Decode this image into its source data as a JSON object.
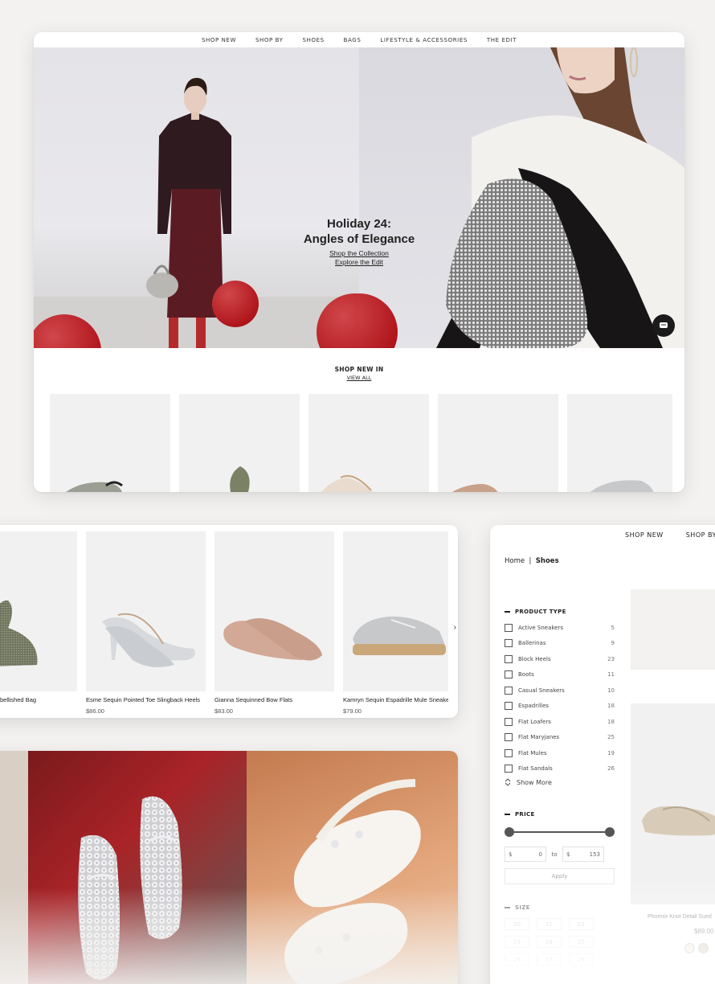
{
  "hero_card": {
    "nav": [
      "SHOP NEW",
      "SHOP BY",
      "SHOES",
      "BAGS",
      "LIFESTYLE & ACCESSORIES",
      "THE EDIT"
    ],
    "hero": {
      "title_line1": "Holiday 24:",
      "title_line2": "Angles of Elegance",
      "link1": "Shop the Collection",
      "link2": "Explore the Edit"
    },
    "chat_icon": "chat-bubble-icon",
    "section_title": "SHOP NEW IN",
    "section_link": "VIEW ALL"
  },
  "products_card": {
    "items": [
      {
        "name": "bellished Bag",
        "price": ""
      },
      {
        "name": "Esme Sequin Pointed Toe Slingback Heels",
        "price": "$86.00"
      },
      {
        "name": "Gianna Sequinned Bow Flats",
        "price": "$83.00"
      },
      {
        "name": "Kamryn Sequin Espadrille Mule Sneakers",
        "price": "$79.00"
      }
    ],
    "next_arrow": "›"
  },
  "shoes_card": {
    "nav": [
      "SHOP NEW",
      "SHOP BY"
    ],
    "breadcrumb": {
      "home": "Home",
      "sep": "|",
      "current": "Shoes"
    },
    "product_type": {
      "heading": "PRODUCT TYPE",
      "options": [
        {
          "label": "Active Sneakers",
          "count": "5"
        },
        {
          "label": "Ballerinas",
          "count": "9"
        },
        {
          "label": "Block Heels",
          "count": "23"
        },
        {
          "label": "Boots",
          "count": "11"
        },
        {
          "label": "Casual Sneakers",
          "count": "10"
        },
        {
          "label": "Espadrilles",
          "count": "18"
        },
        {
          "label": "Flat Loafers",
          "count": "18"
        },
        {
          "label": "Flat Maryjanes",
          "count": "25"
        },
        {
          "label": "Flat Mules",
          "count": "19"
        },
        {
          "label": "Flat Sandals",
          "count": "26"
        }
      ],
      "show_more": "Show More"
    },
    "price": {
      "heading": "PRICE",
      "currency": "$",
      "min": "0",
      "to": "to",
      "max": "153",
      "apply": "Apply"
    },
    "size": {
      "heading": "SIZE",
      "values": [
        "20",
        "21",
        "22",
        "23",
        "24",
        "25",
        "26",
        "27",
        "28"
      ]
    },
    "side_product": {
      "name": "Phoenix Knot Detail Sued",
      "price": "$89.00"
    }
  },
  "colors": {
    "accent_red": "#b3181e",
    "dark": "#1b1b1b",
    "tile_bg": "#f1f1f1"
  }
}
